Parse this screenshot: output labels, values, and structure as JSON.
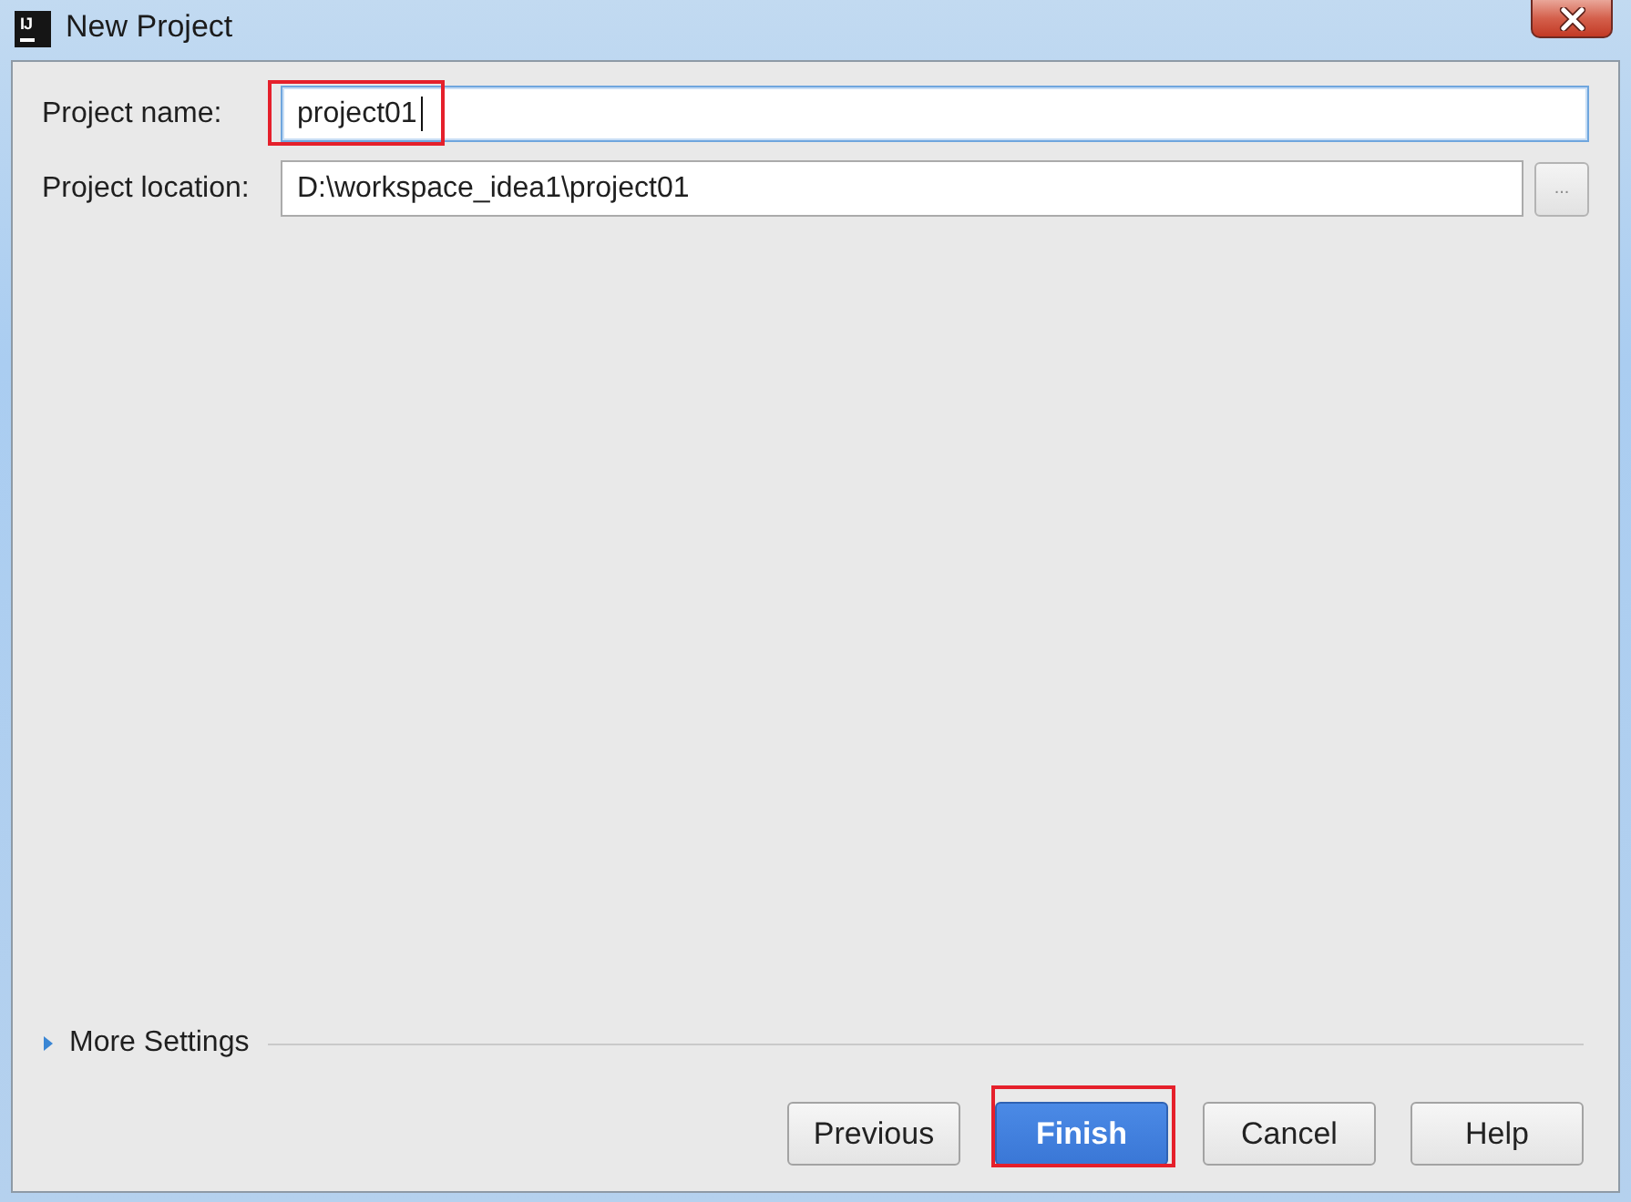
{
  "window": {
    "logo_text": "IJ",
    "title": "New Project"
  },
  "fields": [
    {
      "label": "Project name:",
      "value": "project01",
      "focused": true,
      "highlighted": true
    },
    {
      "label": "Project location:",
      "value": "D:\\workspace_idea1\\project01",
      "focused": false,
      "highlighted": false,
      "browse_label": "..."
    }
  ],
  "more_settings": {
    "label": "More Settings",
    "expanded": false
  },
  "buttons": [
    {
      "label": "Previous",
      "default": false,
      "highlighted": false
    },
    {
      "label": "Finish",
      "default": true,
      "highlighted": true
    },
    {
      "label": "Cancel",
      "default": false,
      "highlighted": false
    },
    {
      "label": "Help",
      "default": false,
      "highlighted": false
    }
  ]
}
